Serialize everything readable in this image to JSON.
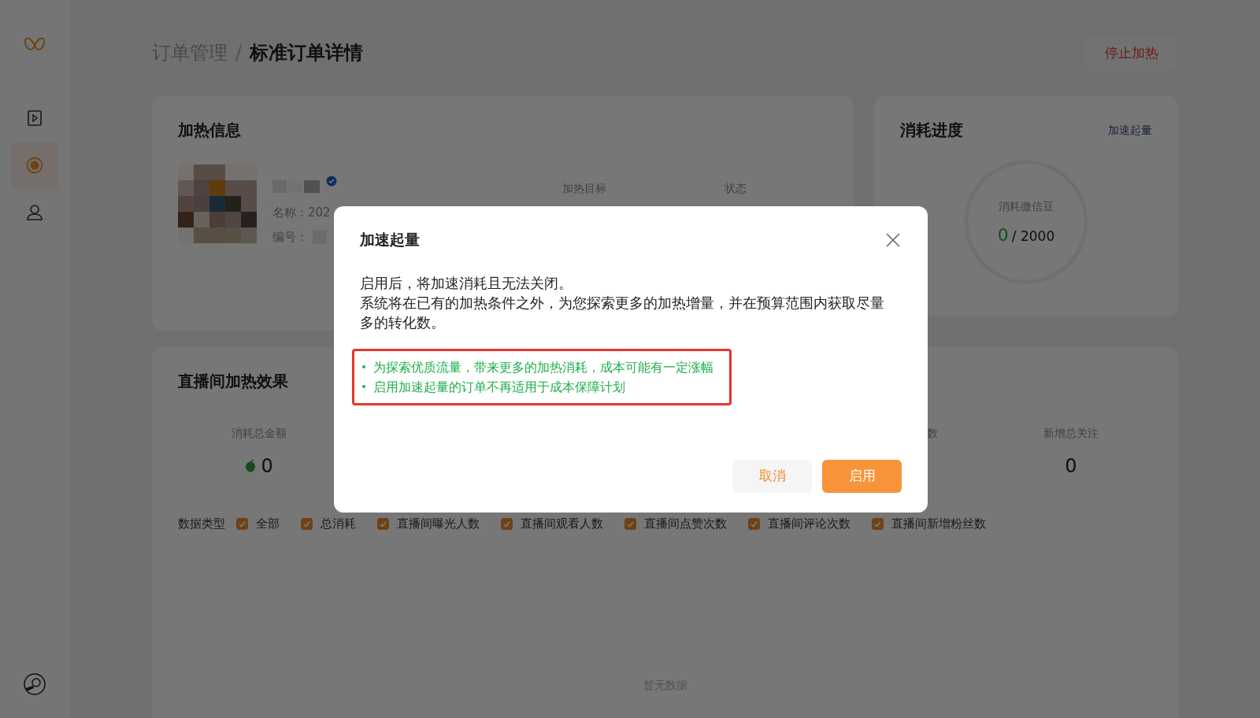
{
  "sidebar": {
    "items": [
      {
        "selected": false
      },
      {
        "selected": true
      },
      {
        "selected": false
      }
    ]
  },
  "breadcrumb": {
    "items": [
      {
        "label": "订单管理",
        "current": false
      },
      {
        "label": "标准订单详情",
        "current": true
      }
    ],
    "separator": "/"
  },
  "stop_button": "停止加热",
  "heat_info": {
    "title": "加热信息",
    "name_label": "名称：202",
    "code_label": "编号：",
    "columns": [
      "加热目标",
      "状态"
    ]
  },
  "progress": {
    "title": "消耗进度",
    "link": "加速起量",
    "ring_label": "消耗微信豆",
    "consumed": "0",
    "total": "/ 2000",
    "level": 0
  },
  "effect": {
    "title": "直播间加热效果",
    "metrics": [
      {
        "label": "消耗总金额",
        "value": "0",
        "kind": "beans"
      },
      {
        "label": "数",
        "kind": "partial"
      },
      {
        "label": "新增总关注",
        "value": "0",
        "kind": "count"
      }
    ],
    "filter": {
      "label": "数据类型",
      "options": [
        {
          "label": "全部",
          "checked": true
        },
        {
          "label": "总消耗",
          "checked": true
        },
        {
          "label": "直播间曝光人数",
          "checked": true
        },
        {
          "label": "直播间观看人数",
          "checked": true
        },
        {
          "label": "直播间点赞次数",
          "checked": true
        },
        {
          "label": "直播间评论次数",
          "checked": true
        },
        {
          "label": "直播间新增粉丝数",
          "checked": true
        }
      ]
    },
    "empty": "暂无数据"
  },
  "dialog": {
    "title": "加速起量",
    "paragraphs": [
      "启用后，将加速消耗且无法关闭。",
      "系统将在已有的加热条件之外，为您探索更多的加热增量，并在预算范围内获取尽量多的转化数。"
    ],
    "notes": [
      "为探索优质流量，带来更多的加热消耗，成本可能有一定涨幅",
      "启用加速起量的订单不再适用于成本保障计划"
    ],
    "buttons": [
      {
        "label": "取消",
        "kind": "secondary"
      },
      {
        "label": "启用",
        "kind": "primary"
      }
    ]
  }
}
